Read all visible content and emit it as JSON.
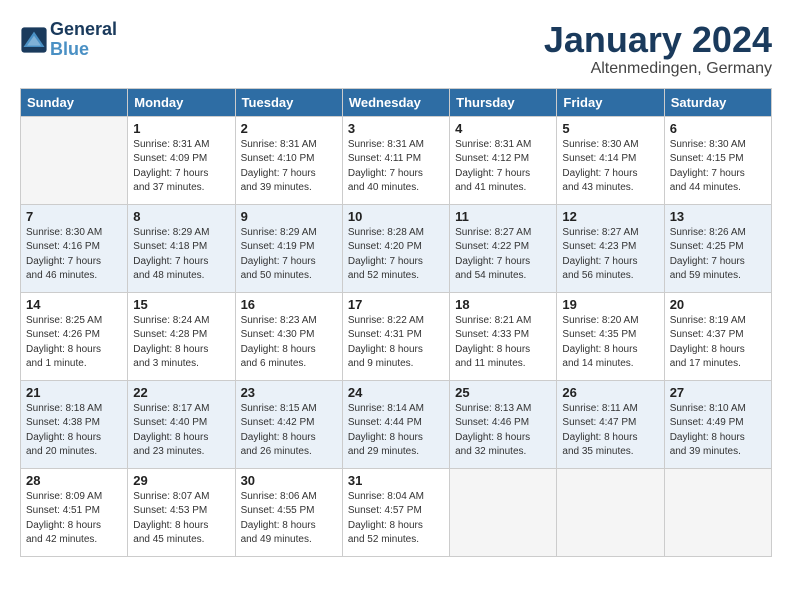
{
  "logo": {
    "text_general": "General",
    "text_blue": "Blue"
  },
  "header": {
    "month": "January 2024",
    "location": "Altenmedingen, Germany"
  },
  "weekdays": [
    "Sunday",
    "Monday",
    "Tuesday",
    "Wednesday",
    "Thursday",
    "Friday",
    "Saturday"
  ],
  "weeks": [
    [
      {
        "day": "",
        "info": ""
      },
      {
        "day": "1",
        "info": "Sunrise: 8:31 AM\nSunset: 4:09 PM\nDaylight: 7 hours\nand 37 minutes."
      },
      {
        "day": "2",
        "info": "Sunrise: 8:31 AM\nSunset: 4:10 PM\nDaylight: 7 hours\nand 39 minutes."
      },
      {
        "day": "3",
        "info": "Sunrise: 8:31 AM\nSunset: 4:11 PM\nDaylight: 7 hours\nand 40 minutes."
      },
      {
        "day": "4",
        "info": "Sunrise: 8:31 AM\nSunset: 4:12 PM\nDaylight: 7 hours\nand 41 minutes."
      },
      {
        "day": "5",
        "info": "Sunrise: 8:30 AM\nSunset: 4:14 PM\nDaylight: 7 hours\nand 43 minutes."
      },
      {
        "day": "6",
        "info": "Sunrise: 8:30 AM\nSunset: 4:15 PM\nDaylight: 7 hours\nand 44 minutes."
      }
    ],
    [
      {
        "day": "7",
        "info": "Sunrise: 8:30 AM\nSunset: 4:16 PM\nDaylight: 7 hours\nand 46 minutes."
      },
      {
        "day": "8",
        "info": "Sunrise: 8:29 AM\nSunset: 4:18 PM\nDaylight: 7 hours\nand 48 minutes."
      },
      {
        "day": "9",
        "info": "Sunrise: 8:29 AM\nSunset: 4:19 PM\nDaylight: 7 hours\nand 50 minutes."
      },
      {
        "day": "10",
        "info": "Sunrise: 8:28 AM\nSunset: 4:20 PM\nDaylight: 7 hours\nand 52 minutes."
      },
      {
        "day": "11",
        "info": "Sunrise: 8:27 AM\nSunset: 4:22 PM\nDaylight: 7 hours\nand 54 minutes."
      },
      {
        "day": "12",
        "info": "Sunrise: 8:27 AM\nSunset: 4:23 PM\nDaylight: 7 hours\nand 56 minutes."
      },
      {
        "day": "13",
        "info": "Sunrise: 8:26 AM\nSunset: 4:25 PM\nDaylight: 7 hours\nand 59 minutes."
      }
    ],
    [
      {
        "day": "14",
        "info": "Sunrise: 8:25 AM\nSunset: 4:26 PM\nDaylight: 8 hours\nand 1 minute."
      },
      {
        "day": "15",
        "info": "Sunrise: 8:24 AM\nSunset: 4:28 PM\nDaylight: 8 hours\nand 3 minutes."
      },
      {
        "day": "16",
        "info": "Sunrise: 8:23 AM\nSunset: 4:30 PM\nDaylight: 8 hours\nand 6 minutes."
      },
      {
        "day": "17",
        "info": "Sunrise: 8:22 AM\nSunset: 4:31 PM\nDaylight: 8 hours\nand 9 minutes."
      },
      {
        "day": "18",
        "info": "Sunrise: 8:21 AM\nSunset: 4:33 PM\nDaylight: 8 hours\nand 11 minutes."
      },
      {
        "day": "19",
        "info": "Sunrise: 8:20 AM\nSunset: 4:35 PM\nDaylight: 8 hours\nand 14 minutes."
      },
      {
        "day": "20",
        "info": "Sunrise: 8:19 AM\nSunset: 4:37 PM\nDaylight: 8 hours\nand 17 minutes."
      }
    ],
    [
      {
        "day": "21",
        "info": "Sunrise: 8:18 AM\nSunset: 4:38 PM\nDaylight: 8 hours\nand 20 minutes."
      },
      {
        "day": "22",
        "info": "Sunrise: 8:17 AM\nSunset: 4:40 PM\nDaylight: 8 hours\nand 23 minutes."
      },
      {
        "day": "23",
        "info": "Sunrise: 8:15 AM\nSunset: 4:42 PM\nDaylight: 8 hours\nand 26 minutes."
      },
      {
        "day": "24",
        "info": "Sunrise: 8:14 AM\nSunset: 4:44 PM\nDaylight: 8 hours\nand 29 minutes."
      },
      {
        "day": "25",
        "info": "Sunrise: 8:13 AM\nSunset: 4:46 PM\nDaylight: 8 hours\nand 32 minutes."
      },
      {
        "day": "26",
        "info": "Sunrise: 8:11 AM\nSunset: 4:47 PM\nDaylight: 8 hours\nand 35 minutes."
      },
      {
        "day": "27",
        "info": "Sunrise: 8:10 AM\nSunset: 4:49 PM\nDaylight: 8 hours\nand 39 minutes."
      }
    ],
    [
      {
        "day": "28",
        "info": "Sunrise: 8:09 AM\nSunset: 4:51 PM\nDaylight: 8 hours\nand 42 minutes."
      },
      {
        "day": "29",
        "info": "Sunrise: 8:07 AM\nSunset: 4:53 PM\nDaylight: 8 hours\nand 45 minutes."
      },
      {
        "day": "30",
        "info": "Sunrise: 8:06 AM\nSunset: 4:55 PM\nDaylight: 8 hours\nand 49 minutes."
      },
      {
        "day": "31",
        "info": "Sunrise: 8:04 AM\nSunset: 4:57 PM\nDaylight: 8 hours\nand 52 minutes."
      },
      {
        "day": "",
        "info": ""
      },
      {
        "day": "",
        "info": ""
      },
      {
        "day": "",
        "info": ""
      }
    ]
  ]
}
